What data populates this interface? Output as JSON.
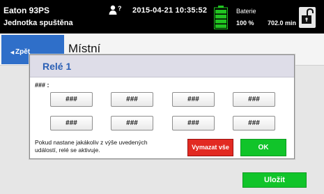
{
  "status_bar": {
    "device_name": "Eaton 93PS",
    "device_status": "Jednotka spuštěna",
    "datetime": "2015-04-21 10:35:52",
    "battery_title": "Baterie",
    "battery_percent": "100 %",
    "battery_runtime": "702.0 min",
    "battery_color": "#21c421",
    "icons": [
      "user-help-icon",
      "battery-icon",
      "unlocked-padlock-icon"
    ]
  },
  "screen": {
    "back_label": "Zpět",
    "title": "Místní",
    "save_label": "Uložit"
  },
  "dialog": {
    "title": "Relé 1",
    "hash_label": "### :",
    "slots": [
      "###",
      "###",
      "###",
      "###",
      "###",
      "###",
      "###",
      "###"
    ],
    "note": "Pokud nastane jakákoliv z výše uvedených událostí, relé se aktivuje.",
    "clear_label": "Vymazat vše",
    "ok_label": "OK"
  },
  "colors": {
    "accent_blue": "#2f6fc9",
    "ok_green": "#11c42a",
    "clear_red": "#e22a22"
  }
}
